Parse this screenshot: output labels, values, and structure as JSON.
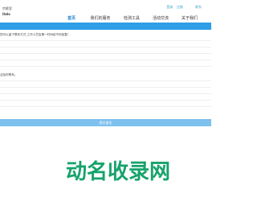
{
  "header": {
    "logo_line1": "宗歌室",
    "logo_line2": "itels",
    "top_links": [
      "登录",
      "注册"
    ],
    "top_link_far": "联系"
  },
  "nav": {
    "items": [
      {
        "label": "首页",
        "active": true
      },
      {
        "label": "我们的服务",
        "active": false
      },
      {
        "label": "检测工具",
        "active": false
      },
      {
        "label": "活动交流",
        "active": false
      },
      {
        "label": "关于我们",
        "active": false
      }
    ]
  },
  "form": {
    "hint_top": "您可以留下联系方式,工作人员会第一时间给予你回复！",
    "hint_mid": "活及时联系。",
    "submit_label": "提交留言"
  },
  "colors": {
    "bluebar": "#2f9ee6",
    "active_nav": "#1e7fc7",
    "submit": "#7ec0ee",
    "watermark": "#16a36b"
  },
  "watermark": {
    "text": "动名收录网"
  }
}
